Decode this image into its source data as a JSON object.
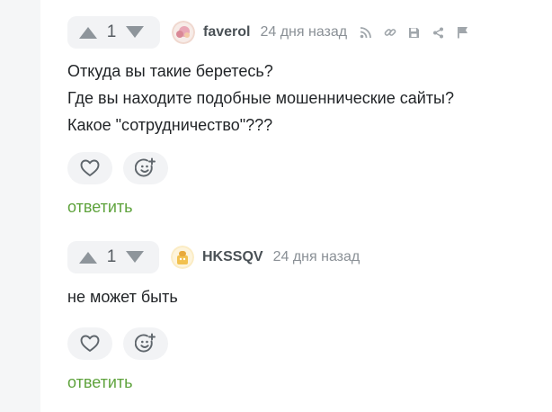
{
  "comments": [
    {
      "votes": "1",
      "username": "faverol",
      "time": "24 дня назад",
      "tools": [
        "rss-icon",
        "link-icon",
        "save-icon",
        "share-icon",
        "flag-icon"
      ],
      "lines": [
        "Откуда вы такие беретесь?",
        "Где вы находите подобные мошеннические сайты?",
        "Какое \"сотрудничество\"???"
      ],
      "reply": "ответить"
    },
    {
      "votes": "1",
      "username": "HKSSQV",
      "time": "24 дня назад",
      "lines": [
        "не может быть"
      ],
      "reply": "ответить"
    }
  ],
  "colors": {
    "reply": "#5fa33d",
    "pill_bg": "#f2f3f5",
    "icon": "#a0a6ab",
    "arrow": "#8e959b"
  }
}
